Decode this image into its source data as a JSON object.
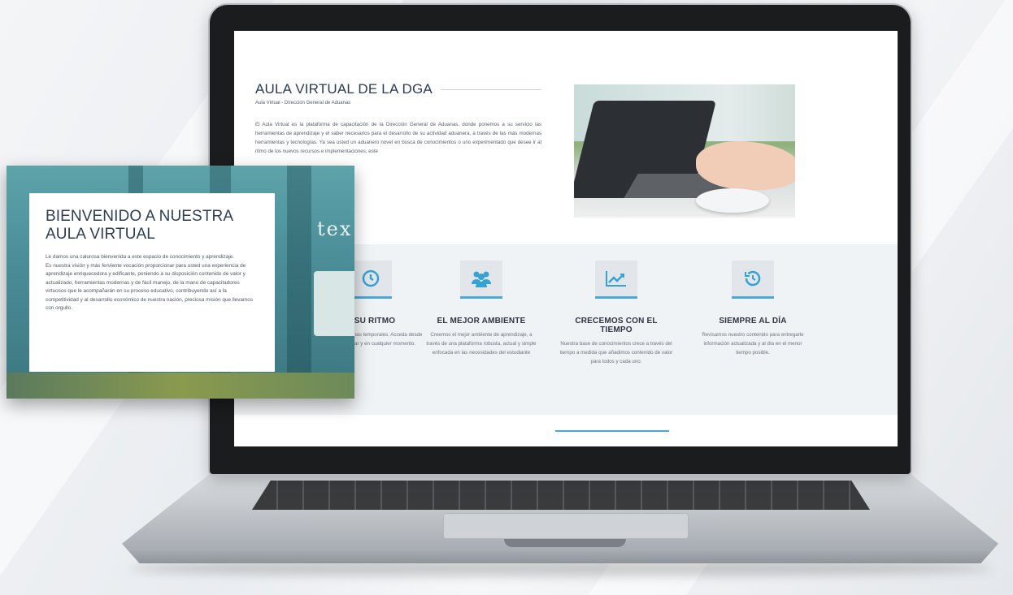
{
  "about": {
    "title": "AULA VIRTUAL DE LA DGA",
    "subtitle": "Aula Virtual - Dirección General de Aduanas",
    "body": "El Aula Virtual es la plataforma de capacitación de la Dirección General de Aduanas, donde ponemos a su servicio las herramientas de aprendizaje y el saber necesarios para el desarrollo de su actividad aduanera, a través de las más modernas herramientas y tecnologías. Ya sea usted un aduanero novel en busca de conocimientos o uno experimentado que desee ir al ritmo de los nuevos recursos e implementaciones, este"
  },
  "features": [
    {
      "title": "A SU RITMO",
      "text": "...horarios y fechas temporales. Acceda desde cualquier lugar y en cualquier momento.",
      "icon": "clock-icon"
    },
    {
      "title": "EL MEJOR AMBIENTE",
      "text": "Creemos el mejor ambiente de aprendizaje, a través de una plataforma robusta, actual y simple enfocada en las necesidades del estudiante",
      "icon": "users-icon"
    },
    {
      "title": "CRECEMOS CON EL TIEMPO",
      "text": "Nuestra base de conocimientos crece a través del tiempo a medida que añadimos contenido de valor para todos y cada uno.",
      "icon": "chart-line-icon"
    },
    {
      "title": "SIEMPRE AL DÍA",
      "text": "Revisamos nuestro contenido para entregarle información actualizada y al día en el menor tiempo posible.",
      "icon": "history-icon"
    }
  ],
  "visible_fragments": {
    "feature1_title": "U RITMO",
    "feature1_text_line1": "orales. Acceda",
    "feature1_text_line2": "en cualquier"
  },
  "welcome": {
    "title": "BIENVENIDO A NUESTRA AULA VIRTUAL",
    "body": "Le damos una calurosa bienvenida a este espacio de conocimiento y aprendizaje.\nEs nuestra visión y más ferviente vocación proporcionar para usted una experiencia de aprendizaje enriquecedora y edificante, poniendo a su disposición contenido de valor y actualizado, herramientas modernas y de fácil manejo, de la mano de capacitadores virtuosos que le acompañarán en su proceso educativo, contribuyendo así a la competitividad y al desarrollo económico de nuestra nación, preciosa misión que llevamos con orgullo.",
    "bg_text": "tex"
  },
  "colors": {
    "accent": "#4aa8d8",
    "heading": "#2b3b55",
    "section_bg": "#f0f3f5"
  }
}
